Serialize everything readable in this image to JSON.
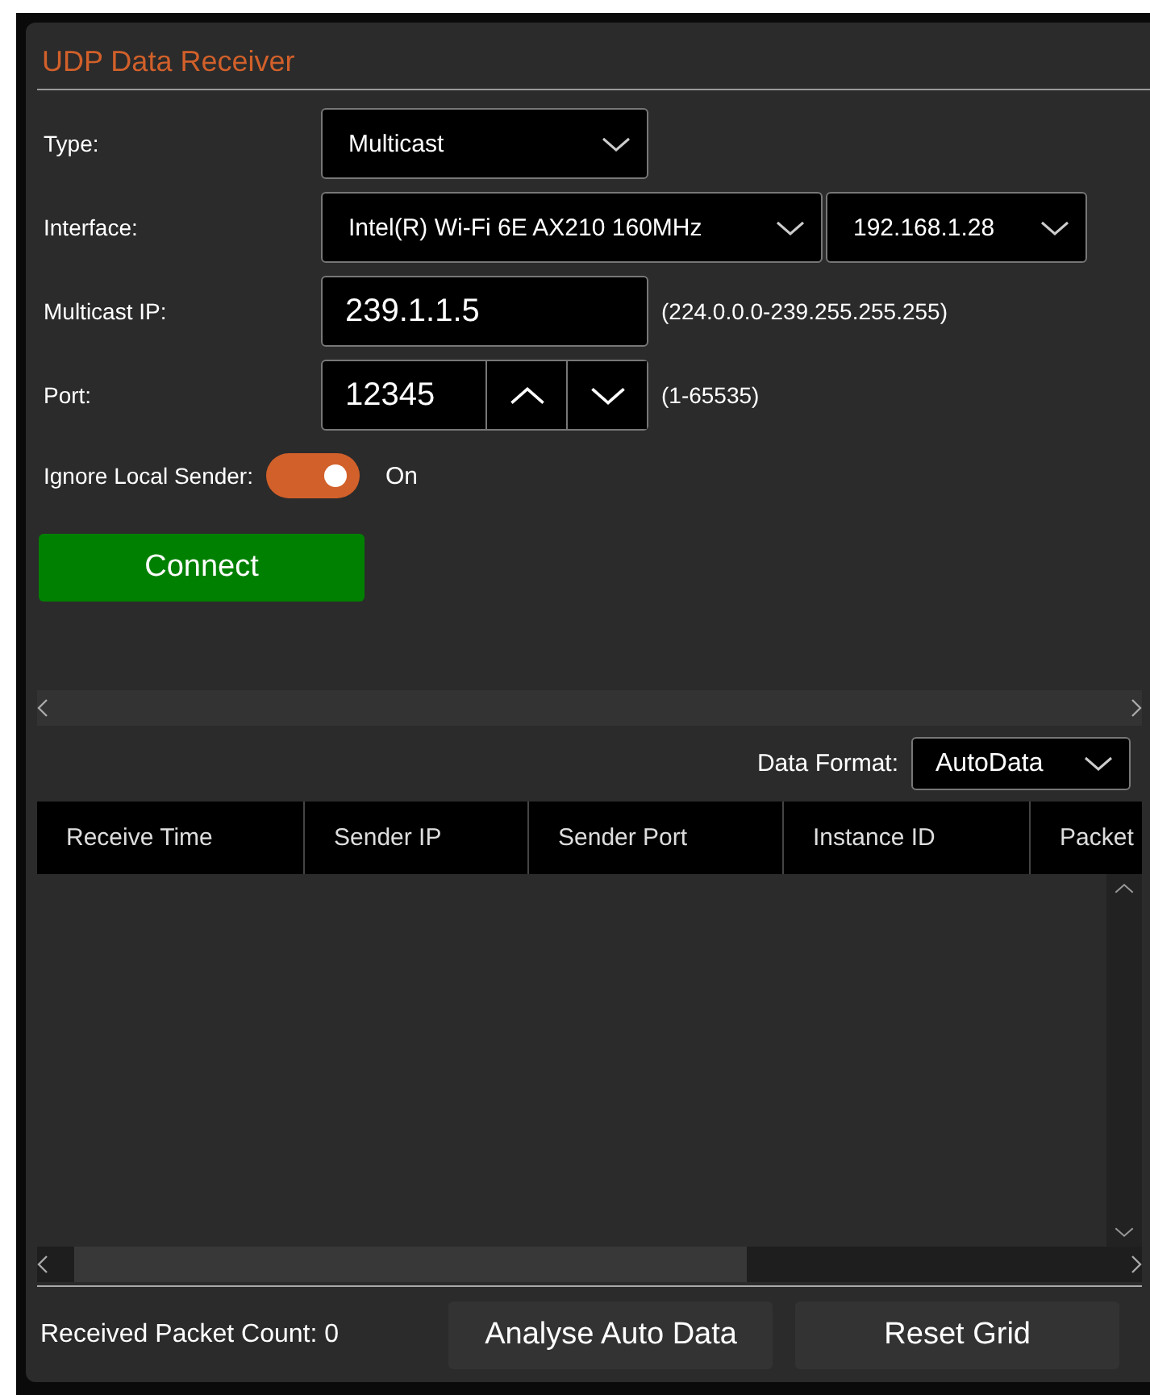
{
  "panel": {
    "title": "UDP Data Receiver"
  },
  "type": {
    "label": "Type:",
    "value": "Multicast"
  },
  "interface": {
    "label": "Interface:",
    "adapter": "Intel(R) Wi-Fi 6E AX210 160MHz",
    "address": "192.168.1.28"
  },
  "multicast_ip": {
    "label": "Multicast IP:",
    "value": "239.1.1.5",
    "hint": "(224.0.0.0-239.255.255.255)"
  },
  "port": {
    "label": "Port:",
    "value": "12345",
    "hint": "(1-65535)"
  },
  "ignore_local_sender": {
    "label": "Ignore Local Sender:",
    "on": true,
    "state_text": "On"
  },
  "connect_button": "Connect",
  "data_format": {
    "label": "Data Format:",
    "value": "AutoData"
  },
  "table": {
    "columns": [
      "Receive Time",
      "Sender IP",
      "Sender Port",
      "Instance ID",
      "Packet"
    ]
  },
  "status": {
    "packet_count": "Received Packet Count: 0"
  },
  "buttons": [
    "Analyse Auto Data",
    "Reset Grid"
  ]
}
